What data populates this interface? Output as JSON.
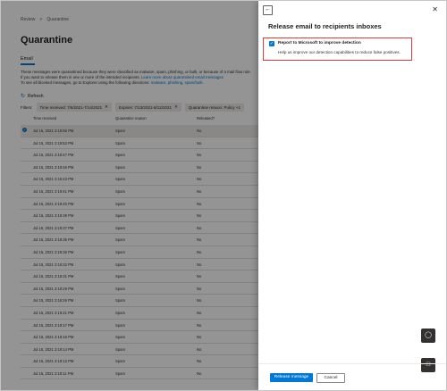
{
  "breadcrumb": [
    "Review",
    ">",
    "Quarantine"
  ],
  "page_title": "Quarantine",
  "tab": "Email",
  "description": {
    "text": "These messages were quarantined because they were classified as malware, spam, phishing, or bulk, or because of a mail flow rule. If you want to release them in one or more of the intended recipients. ",
    "link1": "Learn more about quarantined email messages",
    "text2": "To see all blocked messages, go to Explorer using the following directions: ",
    "link2": "malware, phishing, spam/bulk."
  },
  "refresh_label": "Refresh",
  "filters": {
    "label": "Filters:",
    "chips": [
      "Time received: 7/6/2021-7/14/2021",
      "Expires: 7/13/2021-8/12/2021",
      "Quarantine reason: Policy +1"
    ]
  },
  "table": {
    "headers": [
      "Time received",
      "Quarantine reason",
      "Released?"
    ],
    "rows": [
      {
        "time": "Jul 15, 2021 2:19:55 PM",
        "reason": "Spam",
        "released": "No",
        "selected": true
      },
      {
        "time": "Jul 15, 2021 2:19:53 PM",
        "reason": "Spam",
        "released": "No"
      },
      {
        "time": "Jul 15, 2021 2:19:47 PM",
        "reason": "Spam",
        "released": "No"
      },
      {
        "time": "Jul 15, 2021 2:19:46 PM",
        "reason": "Spam",
        "released": "No"
      },
      {
        "time": "Jul 15, 2021 2:19:43 PM",
        "reason": "Spam",
        "released": "No"
      },
      {
        "time": "Jul 15, 2021 2:19:41 PM",
        "reason": "Spam",
        "released": "No"
      },
      {
        "time": "Jul 15, 2021 2:19:40 PM",
        "reason": "Spam",
        "released": "No"
      },
      {
        "time": "Jul 15, 2021 2:19:39 PM",
        "reason": "Spam",
        "released": "No"
      },
      {
        "time": "Jul 15, 2021 2:19:37 PM",
        "reason": "Spam",
        "released": "No"
      },
      {
        "time": "Jul 15, 2021 2:19:36 PM",
        "reason": "Spam",
        "released": "No"
      },
      {
        "time": "Jul 15, 2021 2:19:35 PM",
        "reason": "Spam",
        "released": "No"
      },
      {
        "time": "Jul 15, 2021 2:19:32 PM",
        "reason": "Spam",
        "released": "No"
      },
      {
        "time": "Jul 15, 2021 2:19:31 PM",
        "reason": "Spam",
        "released": "No"
      },
      {
        "time": "Jul 15, 2021 2:19:29 PM",
        "reason": "Spam",
        "released": "No"
      },
      {
        "time": "Jul 15, 2021 2:19:26 PM",
        "reason": "Spam",
        "released": "No"
      },
      {
        "time": "Jul 15, 2021 2:19:21 PM",
        "reason": "Spam",
        "released": "No"
      },
      {
        "time": "Jul 15, 2021 2:19:17 PM",
        "reason": "Spam",
        "released": "No"
      },
      {
        "time": "Jul 15, 2021 2:19:16 PM",
        "reason": "Spam",
        "released": "No"
      },
      {
        "time": "Jul 15, 2021 2:19:14 PM",
        "reason": "Spam",
        "released": "No"
      },
      {
        "time": "Jul 15, 2021 2:19:13 PM",
        "reason": "Spam",
        "released": "No"
      },
      {
        "time": "Jul 15, 2021 2:19:11 PM",
        "reason": "Spam",
        "released": "No"
      }
    ]
  },
  "panel": {
    "title": "Release email to recipients inboxes",
    "checkbox_label": "Report to Microsoft to improve detection",
    "checkbox_checked": true,
    "checkbox_help": "Help us improve our detection capabilities to reduce false positives.",
    "release_button": "Release message",
    "cancel_button": "Cancel"
  },
  "colors": {
    "accent": "#0078d4",
    "highlight_border": "#e03a3a"
  },
  "icons": {
    "back": "back-arrow-icon",
    "close": "close-icon",
    "refresh": "refresh-icon",
    "help": "help-icon",
    "chat": "chat-icon"
  }
}
